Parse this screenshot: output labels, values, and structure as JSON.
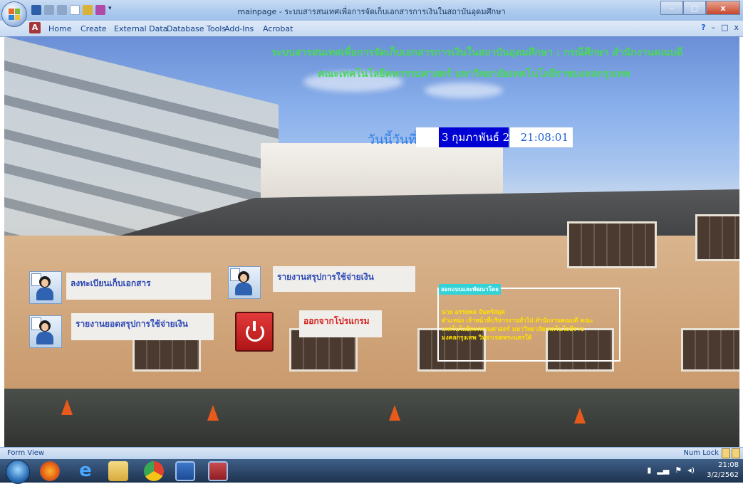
{
  "window": {
    "title": "mainpage - ระบบสารสนเทศเพื่อการจัดเก็บเอกสารการเงินในสถาบันอุดมศึกษา",
    "controls": {
      "minimize": "–",
      "maximize": "□",
      "close": "x"
    }
  },
  "menu": {
    "items": [
      "Home",
      "Create",
      "External Data",
      "Database Tools",
      "Add-Ins",
      "Acrobat"
    ],
    "help": "?",
    "mdi": [
      "–",
      "□",
      "x"
    ]
  },
  "form": {
    "heading_line1": "ระบบสารสนเทศเพื่อการจัดเก็บเอกสารการเงินในสถาบันอุดมศึกษา : กรณีศึกษา สำนักงานคณบดี",
    "heading_line2": "คณะเทคโนโลยีคหกรรมศาสตร์ มหาวิทยาลัยเทคโนโลยีราชมงคลกรุงเทพ",
    "date_label": "วันนี้วันที่",
    "date_value": "3 กุมภาพันธ์ 2",
    "time_value": "21:08:01",
    "buttons": {
      "register": "ลงทะเบียนเก็บเอกสาร",
      "summary_report": "รายงานสรุปการใช้จ่ายเงิน",
      "balance_report": "รายงานยอดสรุปการใช้จ่ายเงิน",
      "exit": "ออกจากโปรแกรม"
    },
    "credit": {
      "title": "ออกแบบและพัฒนาโดย",
      "lines": [
        "นาย อรรถพล  จันทร์สมุด",
        "ตำแหน่ง เจ้าหน้าที่บริหารงานทั่วไป สำนักงานคณบดี คณะ",
        "เทคโนโลยีคหกรรมศาสตร์ มหาวิทยาลัยเทคโนโลยีราช",
        "มงคลกรุงเทพ วิทยาเขตพระนครใต้"
      ]
    }
  },
  "status": {
    "left": "Form View",
    "right": "Num Lock"
  },
  "taskbar": {
    "apps": [
      "firefox-icon",
      "ie-icon",
      "explorer-icon",
      "chrome-icon",
      "word-icon",
      "access-icon"
    ],
    "clock_time": "21:08",
    "clock_date": "3/2/2562"
  },
  "colors": {
    "heading": "#4ad85a",
    "date_label": "#2f7ee6",
    "selection": "#0000d4",
    "button_text": "#2c48b6",
    "exit_text": "#d4211f",
    "credit_text": "#ffe000",
    "credit_title_bg": "#32d3d8"
  }
}
